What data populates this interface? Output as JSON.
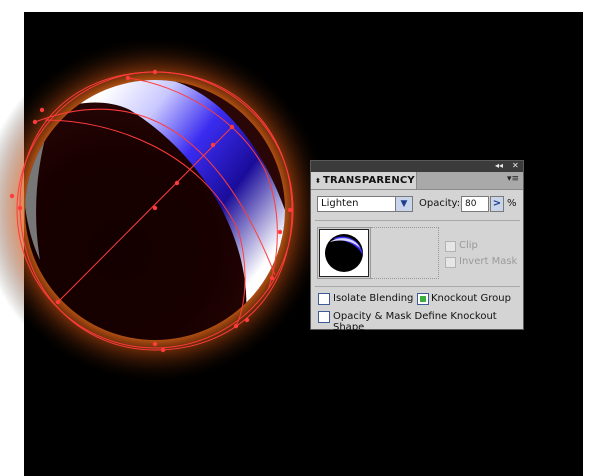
{
  "panel": {
    "tab_title": "TRANSPARENCY",
    "tab_arrows": "⬍",
    "collapse_icon": "◂◂",
    "close_icon": "✕",
    "menu_icon": "▾≡",
    "blend_mode": "Lighten",
    "opacity_label": "Opacity:",
    "opacity_value": "80",
    "opacity_unit": "%",
    "clip_label": "Clip",
    "invert_mask_label": "Invert Mask",
    "isolate_blending_label": "Isolate Blending",
    "isolate_blending_checked": false,
    "knockout_group_label": "Knockout Group",
    "knockout_group_checked": true,
    "opacity_mask_label": "Opacity & Mask Define Knockout Shape",
    "opacity_mask_checked": false
  },
  "colors": {
    "artboard": "#000000",
    "glow": "#ff7a1a",
    "sphere_highlight": "#3a2cf0",
    "path_stroke": "#ff3b3b",
    "checkbox_active": "#3cae3c"
  }
}
